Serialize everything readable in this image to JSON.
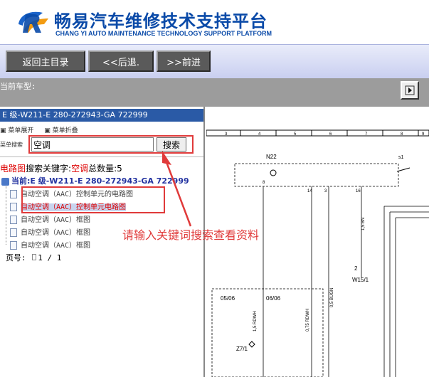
{
  "header": {
    "title_cn": "畅易汽车维修技术支持平台",
    "title_en": "CHANG YI AUTO MAINTENANCE TECHNOLOGY SUPPORT PLATFORM"
  },
  "nav": {
    "home": "返回主目录",
    "back": "<<后退.",
    "forward": ">>前进"
  },
  "current_model_label": "当前车型:",
  "left": {
    "model_title": "E 级-W211-E 280-272943-GA 722999",
    "expand_label": "菜单展开",
    "collapse_label": "菜单折叠",
    "search_label": "菜单搜索",
    "search_value": "空调",
    "search_button": "搜索",
    "result_prefix": "电路图",
    "result_kw_label": "搜索关键字:",
    "result_kw": "空调",
    "result_count_label": "总数量:",
    "result_count": "5",
    "tree_root": "当前:E 级-W211-E 280-272943-GA 722999",
    "items": [
      "自动空调（AAC）控制单元的电路图",
      "自动空调（AAC）控制单元电路图",
      "自动空调（AAC）框图",
      "自动空调（AAC）框图",
      "自动空调（AAC）框图"
    ],
    "page_label": "页号:",
    "page_value": "1 / 1"
  },
  "annotation": "请输入关键词搜索查看资料",
  "diagram": {
    "ruler": [
      "3",
      "4",
      "5",
      "6",
      "7",
      "8",
      "9"
    ],
    "labels": {
      "n22": "N22",
      "s1": "s1",
      "p8": "8",
      "p14": "14",
      "p3": "3",
      "p16": "16",
      "bn": "1,5 BN",
      "two": "2",
      "w15": "W15/1",
      "c0506": "05/06",
      "c0606": "06/06",
      "bugn": "0,5 BUGN",
      "rdwh1": "1,5 RDWH",
      "rdwh2": "0,75 RDWH",
      "z71": "Z7/1"
    }
  },
  "colors": {
    "brand_blue": "#0a4aa8",
    "model_bar": "#2a5aa6",
    "highlight_red": "#e03a3a"
  }
}
